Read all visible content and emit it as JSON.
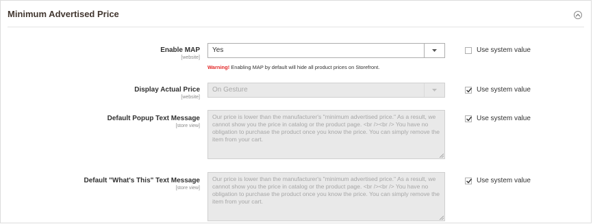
{
  "section": {
    "title": "Minimum Advertised Price"
  },
  "icons": {
    "collapse": "chevron-up-circle-icon",
    "dropdown": "triangle-down-icon",
    "checkmark": "checkmark-icon",
    "resize": "resize-grip-icon"
  },
  "colors": {
    "warning": "#e22626",
    "disabled_field": "#e9e9e9",
    "border": "#adadad"
  },
  "fields": [
    {
      "label": "Enable MAP",
      "scope": "[website]",
      "type": "select",
      "value": "Yes",
      "disabled": false,
      "use_system_value": false,
      "use_system_label": "Use system value",
      "warning_strong": "Warning!",
      "warning_text": " Enabling MAP by default will hide all product prices on Storefront."
    },
    {
      "label": "Display Actual Price",
      "scope": "[website]",
      "type": "select",
      "value": "On Gesture",
      "disabled": true,
      "use_system_value": true,
      "use_system_label": "Use system value"
    },
    {
      "label": "Default Popup Text Message",
      "scope": "[store view]",
      "type": "textarea",
      "value": "Our price is lower than the manufacturer's \"minimum advertised price.\" As a result, we cannot show you the price in catalog or the product page. <br /><br /> You have no obligation to purchase the product once you know the price. You can simply remove the item from your cart.",
      "disabled": true,
      "use_system_value": true,
      "use_system_label": "Use system value"
    },
    {
      "label": "Default \"What's This\" Text Message",
      "scope": "[store view]",
      "type": "textarea",
      "value": "Our price is lower than the manufacturer's \"minimum advertised price.\" As a result, we cannot show you the price in catalog or the product page. <br /><br /> You have no obligation to purchase the product once you know the price. You can simply remove the item from your cart.",
      "disabled": true,
      "use_system_value": true,
      "use_system_label": "Use system value"
    }
  ]
}
